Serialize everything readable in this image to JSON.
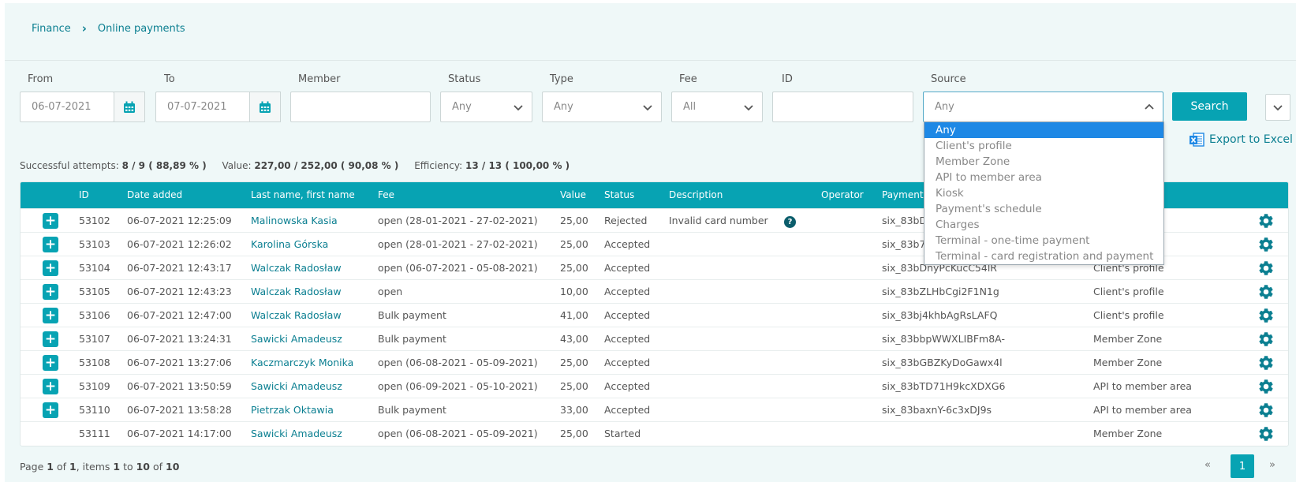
{
  "breadcrumb": {
    "finance": "Finance",
    "page": "Online payments"
  },
  "filters": {
    "from_label": "From",
    "from_value": "06-07-2021",
    "to_label": "To",
    "to_value": "07-07-2021",
    "member_label": "Member",
    "member_value": "",
    "status_label": "Status",
    "status_value": "Any",
    "type_label": "Type",
    "type_value": "Any",
    "fee_label": "Fee",
    "fee_value": "All",
    "id_label": "ID",
    "id_value": "",
    "source_label": "Source",
    "source_value": "Any",
    "source_options": [
      "Any",
      "Client's profile",
      "Member Zone",
      "API to member area",
      "Kiosk",
      "Payment's schedule",
      "Charges",
      "Terminal - one-time payment",
      "Terminal - card registration and payment"
    ]
  },
  "search_label": "Search",
  "export_label": "Export to Excel",
  "stats": {
    "success_label": "Successful attempts:",
    "success_value": "8 / 9 ( 88,89 % )",
    "value_label": "Value:",
    "value_value": "227,00 / 252,00 ( 90,08 % )",
    "efficiency_label": "Efficiency:",
    "efficiency_value": "13 / 13 ( 100,00 % )"
  },
  "table": {
    "headers": {
      "id": "ID",
      "date": "Date added",
      "name": "Last name, first name",
      "fee": "Fee",
      "value": "Value",
      "status": "Status",
      "description": "Description",
      "operator": "Operator",
      "payment": "Payment I"
    },
    "rows": [
      {
        "expand": true,
        "id": "53102",
        "date": "06-07-2021 12:25:09",
        "name": "Malinowska Kasia",
        "fee": "open (28-01-2021 - 27-02-2021)",
        "value": "25,00",
        "status": "Rejected",
        "description": "Invalid card number",
        "payment": "six_83bD",
        "source": ""
      },
      {
        "expand": true,
        "id": "53103",
        "date": "06-07-2021 12:26:02",
        "name": "Karolina Górska",
        "fee": "open (28-01-2021 - 27-02-2021)",
        "value": "25,00",
        "status": "Accepted",
        "description": "",
        "payment": "six_83b7",
        "source": ""
      },
      {
        "expand": true,
        "id": "53104",
        "date": "06-07-2021 12:43:17",
        "name": "Walczak Radosław",
        "fee": "open (06-07-2021 - 05-08-2021)",
        "value": "25,00",
        "status": "Accepted",
        "description": "",
        "payment": "six_83bDnyPcKucC54lR",
        "source": "Client's profile"
      },
      {
        "expand": true,
        "id": "53105",
        "date": "06-07-2021 12:43:23",
        "name": "Walczak Radosław",
        "fee": "open",
        "value": "10,00",
        "status": "Accepted",
        "description": "",
        "payment": "six_83bZLHbCgi2F1N1g",
        "source": "Client's profile"
      },
      {
        "expand": true,
        "id": "53106",
        "date": "06-07-2021 12:47:00",
        "name": "Walczak Radosław",
        "fee": "Bulk payment",
        "value": "41,00",
        "status": "Accepted",
        "description": "",
        "payment": "six_83bj4khbAgRsLAFQ",
        "source": "Client's profile"
      },
      {
        "expand": true,
        "id": "53107",
        "date": "06-07-2021 13:24:31",
        "name": "Sawicki Amadeusz",
        "fee": "Bulk payment",
        "value": "43,00",
        "status": "Accepted",
        "description": "",
        "payment": "six_83bbpWWXLIBFm8A-",
        "source": "Member Zone"
      },
      {
        "expand": true,
        "id": "53108",
        "date": "06-07-2021 13:27:06",
        "name": "Kaczmarczyk Monika",
        "fee": "open (06-08-2021 - 05-09-2021)",
        "value": "25,00",
        "status": "Accepted",
        "description": "",
        "payment": "six_83bGBZKyDoGawx4l",
        "source": "Member Zone"
      },
      {
        "expand": true,
        "id": "53109",
        "date": "06-07-2021 13:50:59",
        "name": "Sawicki Amadeusz",
        "fee": "open (06-09-2021 - 05-10-2021)",
        "value": "25,00",
        "status": "Accepted",
        "description": "",
        "payment": "six_83bTD71H9kcXDXG6",
        "source": "API to member area"
      },
      {
        "expand": true,
        "id": "53110",
        "date": "06-07-2021 13:58:28",
        "name": "Pietrzak Oktawia",
        "fee": "Bulk payment",
        "value": "33,00",
        "status": "Accepted",
        "description": "",
        "payment": "six_83baxnY-6c3xDJ9s",
        "source": "API to member area"
      },
      {
        "expand": false,
        "id": "53111",
        "date": "06-07-2021 14:17:00",
        "name": "Sawicki Amadeusz",
        "fee": "open (06-08-2021 - 05-09-2021)",
        "value": "25,00",
        "status": "Started",
        "description": "",
        "payment": "",
        "source": "Member Zone"
      }
    ]
  },
  "pagination": {
    "page_word": "Page",
    "page": "1",
    "of_word": "of",
    "pages": "1",
    "items_word": ", items",
    "from": "1",
    "to_word": "to",
    "to": "10",
    "of2_word": "of",
    "total": "10",
    "prev": "«",
    "current": "1",
    "next": "»"
  },
  "colors": {
    "accent": "#07a3b3",
    "link": "#0b7f91",
    "dropdown_selected": "#1e88e5"
  },
  "icons": {
    "calendar": "calendar-icon",
    "chevron": "chevron-down-icon",
    "gear": "gear-icon",
    "excel": "excel-icon",
    "help": "help-icon"
  }
}
